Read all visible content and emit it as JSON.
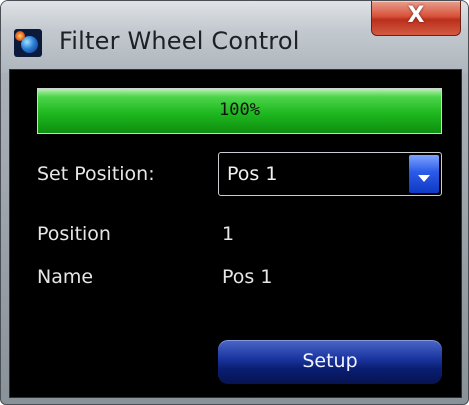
{
  "window": {
    "title": "Filter Wheel Control",
    "close_glyph": "X",
    "app_icon": "telescope-app-icon"
  },
  "progress": {
    "text": "100%",
    "fraction": 1.0,
    "color": "#1fb81f"
  },
  "set_position": {
    "label": "Set Position:",
    "selected": "Pos 1"
  },
  "status": {
    "position_label": "Position",
    "position_value": "1",
    "name_label": "Name",
    "name_value": "Pos 1"
  },
  "buttons": {
    "setup_label": "Setup"
  }
}
